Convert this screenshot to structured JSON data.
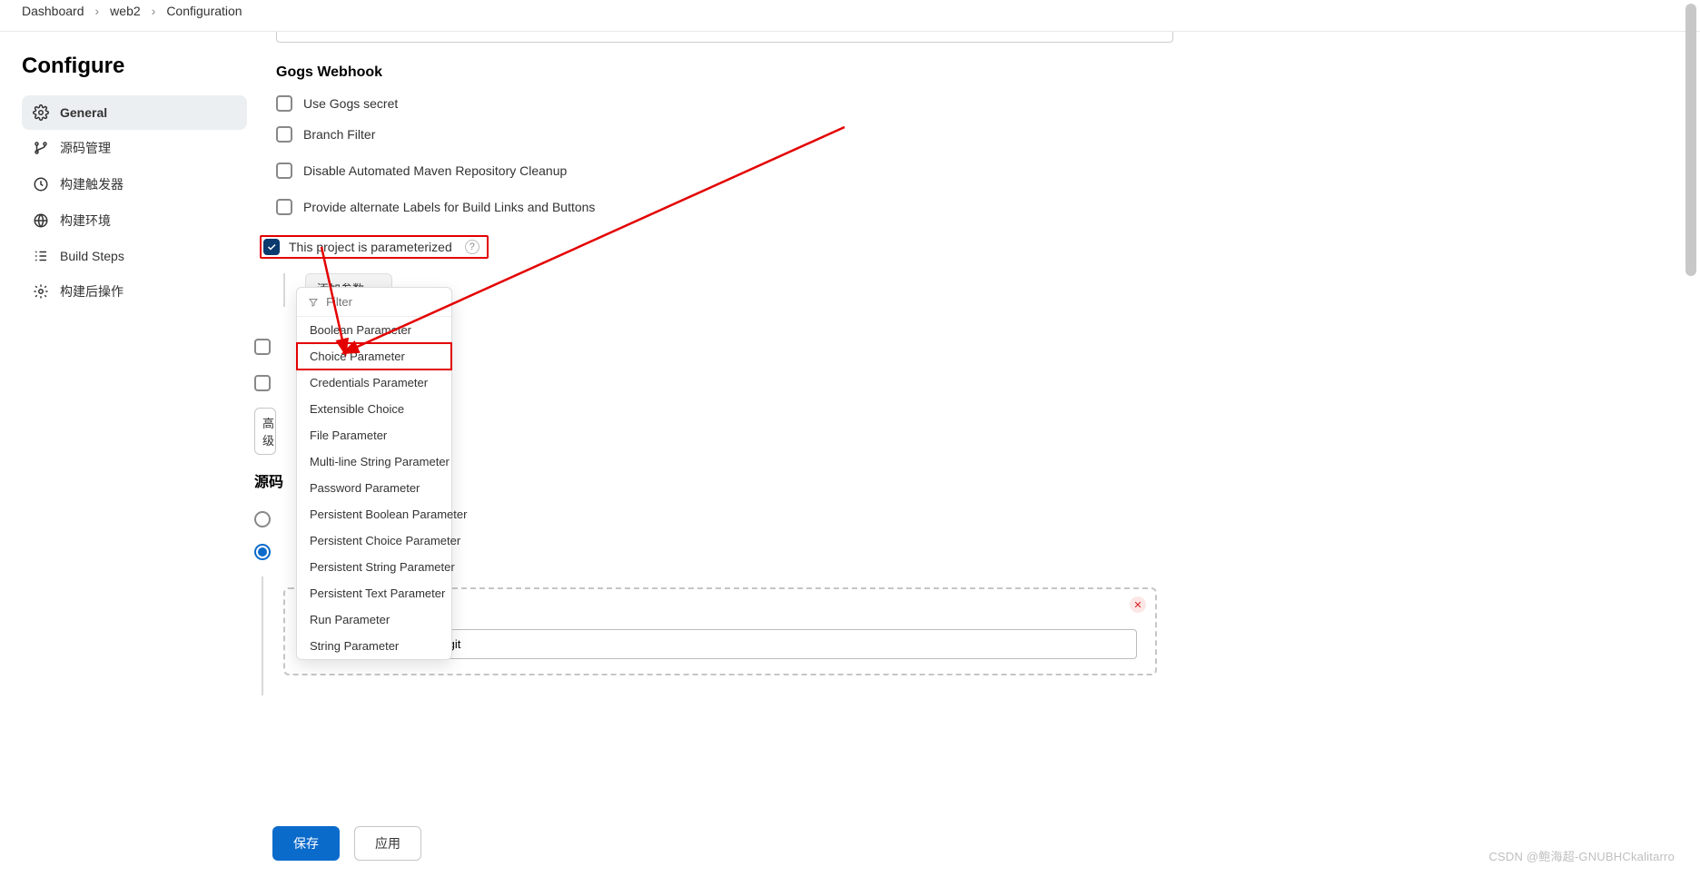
{
  "breadcrumb": [
    "Dashboard",
    "web2",
    "Configuration"
  ],
  "page_title": "Configure",
  "sidebar": {
    "items": [
      {
        "label": "General",
        "active": true
      },
      {
        "label": "源码管理",
        "active": false
      },
      {
        "label": "构建触发器",
        "active": false
      },
      {
        "label": "构建环境",
        "active": false
      },
      {
        "label": "Build Steps",
        "active": false
      },
      {
        "label": "构建后操作",
        "active": false
      }
    ]
  },
  "webhook": {
    "title": "Gogs Webhook",
    "checkboxes": [
      {
        "label": "Use Gogs secret",
        "checked": false
      },
      {
        "label": "Branch Filter",
        "checked": false
      },
      {
        "label": "Disable Automated Maven Repository Cleanup",
        "checked": false
      },
      {
        "label": "Provide alternate Labels for Build Links and Buttons",
        "checked": false
      }
    ],
    "parameterized": {
      "label": "This project is parameterized",
      "checked": true
    },
    "add_param_label": "添加参数",
    "filter_placeholder": "Filter",
    "param_options": [
      "Boolean Parameter",
      "Choice Parameter",
      "Credentials Parameter",
      "Extensible Choice",
      "File Parameter",
      "Multi-line String Parameter",
      "Password Parameter",
      "Persistent Boolean Parameter",
      "Persistent Choice Parameter",
      "Persistent String Parameter",
      "Persistent Text Parameter",
      "Run Parameter",
      "String Parameter"
    ],
    "highlighted_option_index": 1,
    "advanced_button_trunc": "高级"
  },
  "source": {
    "title": "源码",
    "repo_url": "git@172.20.10.4:root/web.git"
  },
  "buttons": {
    "save": "保存",
    "apply": "应用"
  },
  "watermark": "CSDN @鲍海超-GNUBHCkalitarro",
  "help_char": "?"
}
